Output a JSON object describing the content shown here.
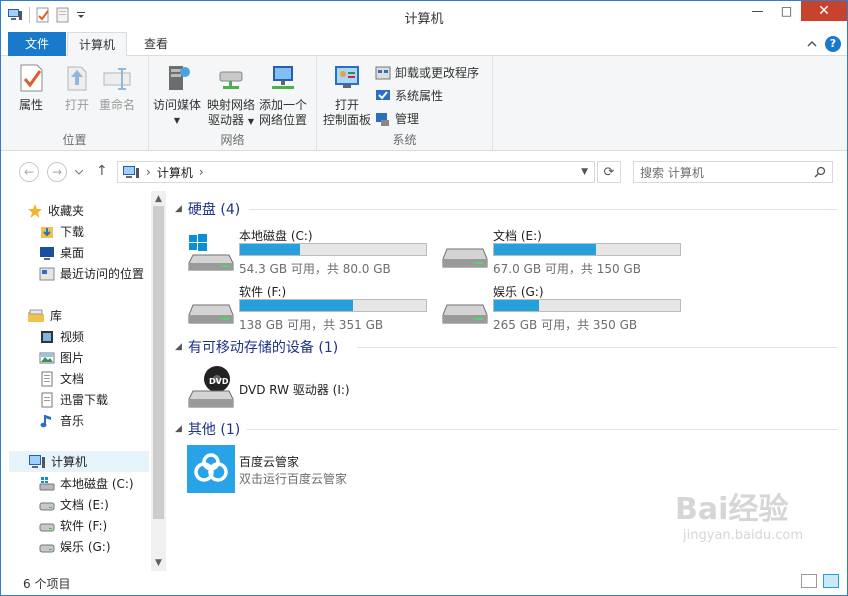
{
  "window": {
    "title": "计算机"
  },
  "qat": {
    "icons": [
      "computer-icon",
      "properties-icon",
      "new-folder-icon",
      "customize-arrow-icon"
    ]
  },
  "window_buttons": {
    "minimize": "—",
    "maximize": "□",
    "close": "✕"
  },
  "ribbon_tabs": {
    "file": "文件",
    "computer": "计算机",
    "view": "查看"
  },
  "ribbon": {
    "location": {
      "label": "位置",
      "properties": "属性",
      "open": "打开",
      "rename": "重命名"
    },
    "network": {
      "label": "网络",
      "access_media": "访问媒体",
      "map_drive_line1": "映射网络",
      "map_drive_line2": "驱动器",
      "add_location_line1": "添加一个",
      "add_location_line2": "网络位置"
    },
    "system": {
      "label": "系统",
      "open_cp_line1": "打开",
      "open_cp_line2": "控制面板",
      "uninstall": "卸载或更改程序",
      "sys_props": "系统属性",
      "manage": "管理"
    }
  },
  "address": {
    "path": "计算机",
    "search_placeholder": "搜索 计算机"
  },
  "nav_pane": {
    "favorites": "收藏夹",
    "downloads": "下载",
    "desktop": "桌面",
    "recent": "最近访问的位置",
    "libraries": "库",
    "videos": "视频",
    "pictures": "图片",
    "documents": "文档",
    "xunlei": "迅雷下载",
    "music": "音乐",
    "computer": "计算机",
    "drive_c": "本地磁盘 (C:)",
    "drive_e": "文档 (E:)",
    "drive_f": "软件 (F:)",
    "drive_g": "娱乐 (G:)"
  },
  "sections": {
    "hdd": "硬盘 (4)",
    "removable": "有可移动存储的设备 (1)",
    "other": "其他 (1)"
  },
  "drives": [
    {
      "name": "本地磁盘 (C:)",
      "free": "54.3 GB 可用，共 80.0 GB",
      "used_fraction": 0.32
    },
    {
      "name": "文档 (E:)",
      "free": "67.0 GB 可用，共 150 GB",
      "used_fraction": 0.55
    },
    {
      "name": "软件 (F:)",
      "free": "138 GB 可用，共 351 GB",
      "used_fraction": 0.61
    },
    {
      "name": "娱乐 (G:)",
      "free": "265 GB 可用，共 350 GB",
      "used_fraction": 0.24
    }
  ],
  "removable": {
    "name": "DVD RW 驱动器 (I:)",
    "badge": "DVD"
  },
  "other": {
    "name": "百度云管家",
    "desc": "双击运行百度云管家"
  },
  "status": {
    "count": "6 个项目"
  },
  "watermark": {
    "text": "Bai经验",
    "url": "jingyan.baidu.com"
  },
  "colors": {
    "accent": "#1979ca",
    "bar_fill": "#26a0da",
    "section_text": "#1e3287"
  }
}
